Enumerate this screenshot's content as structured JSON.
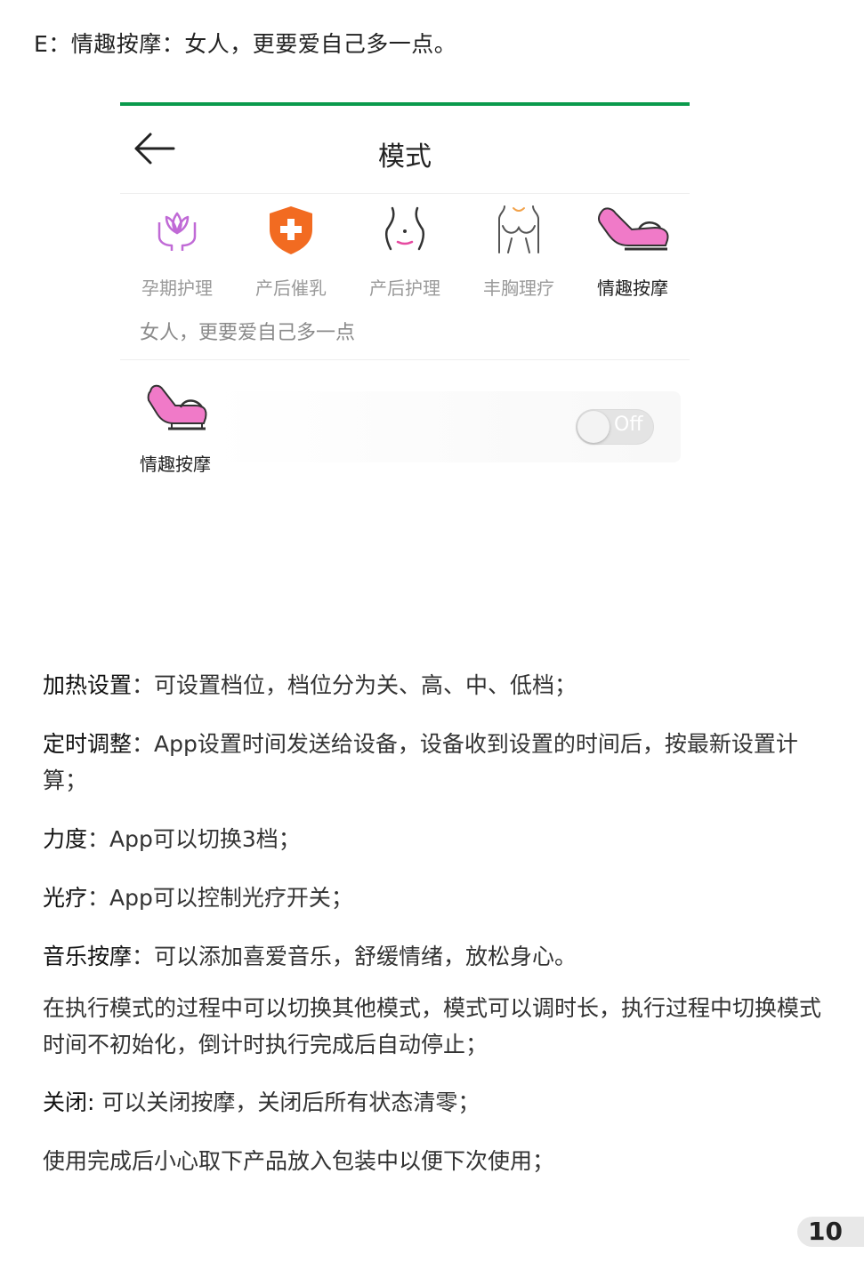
{
  "heading": "E：情趣按摩：女人，更要爱自己多一点。",
  "app": {
    "accent_color": "#0a9a4c",
    "title": "模式",
    "back_icon": "back-arrow-icon",
    "modes": [
      {
        "label": "孕期护理",
        "icon": "lotus-hands-icon",
        "active": false
      },
      {
        "label": "产后催乳",
        "icon": "medical-shield-icon",
        "active": false
      },
      {
        "label": "产后护理",
        "icon": "abdomen-icon",
        "active": false
      },
      {
        "label": "丰胸理疗",
        "icon": "chest-icon",
        "active": false
      },
      {
        "label": "情趣按摩",
        "icon": "massage-chair-icon",
        "active": true
      }
    ],
    "description": "女人，更要爱自己多一点",
    "current_item": {
      "label": "情趣按摩",
      "icon": "massage-chair-icon",
      "toggle_text": "Off",
      "toggle_on": false
    },
    "icon_color_pink": "#f07ac8",
    "icon_color_orange": "#f26b21"
  },
  "features": [
    {
      "label": "加热设置",
      "sep": "：",
      "text": "可设置档位，档位分为关、高、中、低档；"
    },
    {
      "label": "定时调整",
      "sep": "：",
      "text": "App设置时间发送给设备，设备收到设置的时间后，按最新设置计算；"
    },
    {
      "label": "力度",
      "sep": "：",
      "text": "App可以切换3档；"
    },
    {
      "label": "光疗",
      "sep": "：",
      "text": "App可以控制光疗开关；"
    },
    {
      "label": "音乐按摩",
      "sep": "：",
      "text": "可以添加喜爱音乐，舒缓情绪，放松身心。"
    }
  ],
  "note": "在执行模式的过程中可以切换其他模式，模式可以调时长，执行过程中切换模式时间不初始化，倒计时执行完成后自动停止；",
  "close": {
    "label": "关闭:",
    "text": " 可以关闭按摩，关闭后所有状态清零；"
  },
  "final": "使用完成后小心取下产品放入包装中以便下次使用；",
  "page_number": "10"
}
